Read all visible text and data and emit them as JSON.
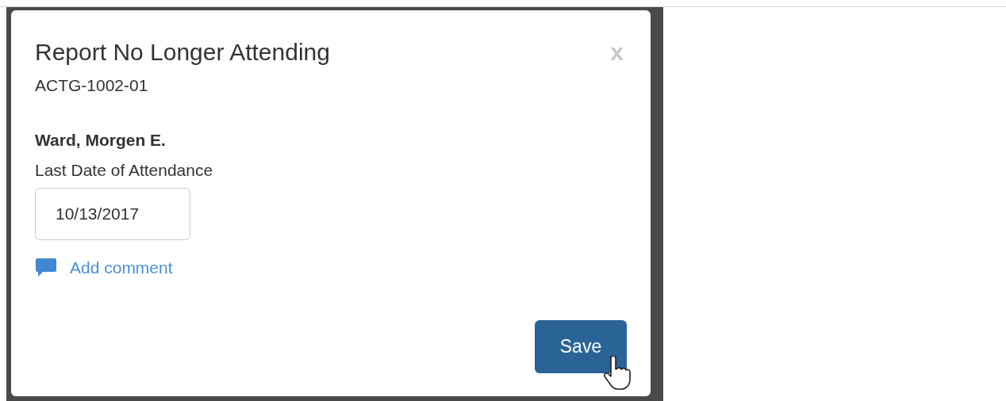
{
  "dialog": {
    "title": "Report No Longer Attending",
    "close": "x",
    "subtitle": "ACTG-1002-01",
    "student": "Ward, Morgen E.",
    "date_field": {
      "label": "Last Date of Attendance",
      "value": "10/13/2017"
    },
    "comment_link": "Add comment",
    "buttons": [
      "Save"
    ]
  }
}
